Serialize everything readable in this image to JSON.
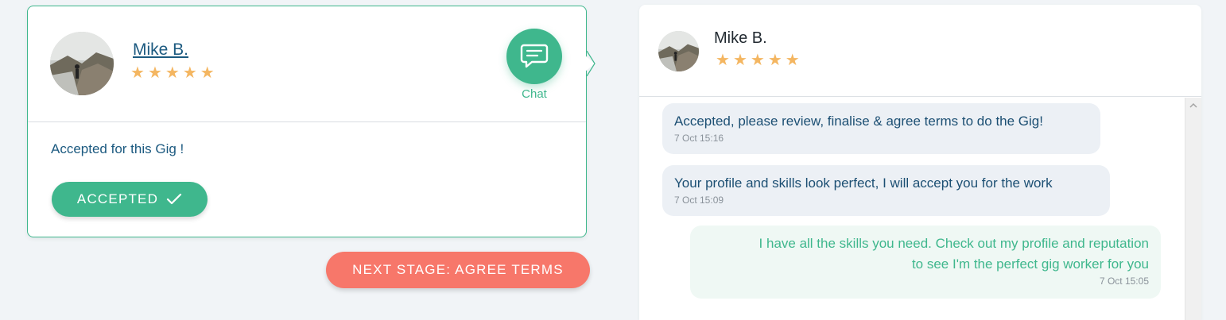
{
  "worker_card": {
    "name": "Mike B.",
    "rating": 5,
    "chat_label": "Chat",
    "status_text": "Accepted for this Gig !",
    "accepted_button": "ACCEPTED",
    "next_stage_button": "NEXT STAGE: AGREE TERMS"
  },
  "chat_panel": {
    "name": "Mike B.",
    "rating": 5,
    "messages": [
      {
        "direction": "incoming",
        "text": "Accepted, please review, finalise & agree terms to do the Gig!",
        "time": "7 Oct 15:16"
      },
      {
        "direction": "incoming",
        "text": "Your profile and skills look perfect, I will accept you for the work",
        "time": "7 Oct 15:09"
      },
      {
        "direction": "outgoing",
        "text_line1": "I have all the skills you need. Check out my profile and reputation",
        "text_line2": "to see I'm the perfect gig worker for you",
        "time": "7 Oct 15:05"
      }
    ]
  },
  "colors": {
    "accent_green": "#3fb78d",
    "next_stage_coral": "#f7776a",
    "star_gold": "#f4b661",
    "name_blue": "#1c5a80"
  },
  "icons": [
    "chat-bubble-icon",
    "check-icon",
    "star-icon",
    "scroll-up-icon"
  ]
}
